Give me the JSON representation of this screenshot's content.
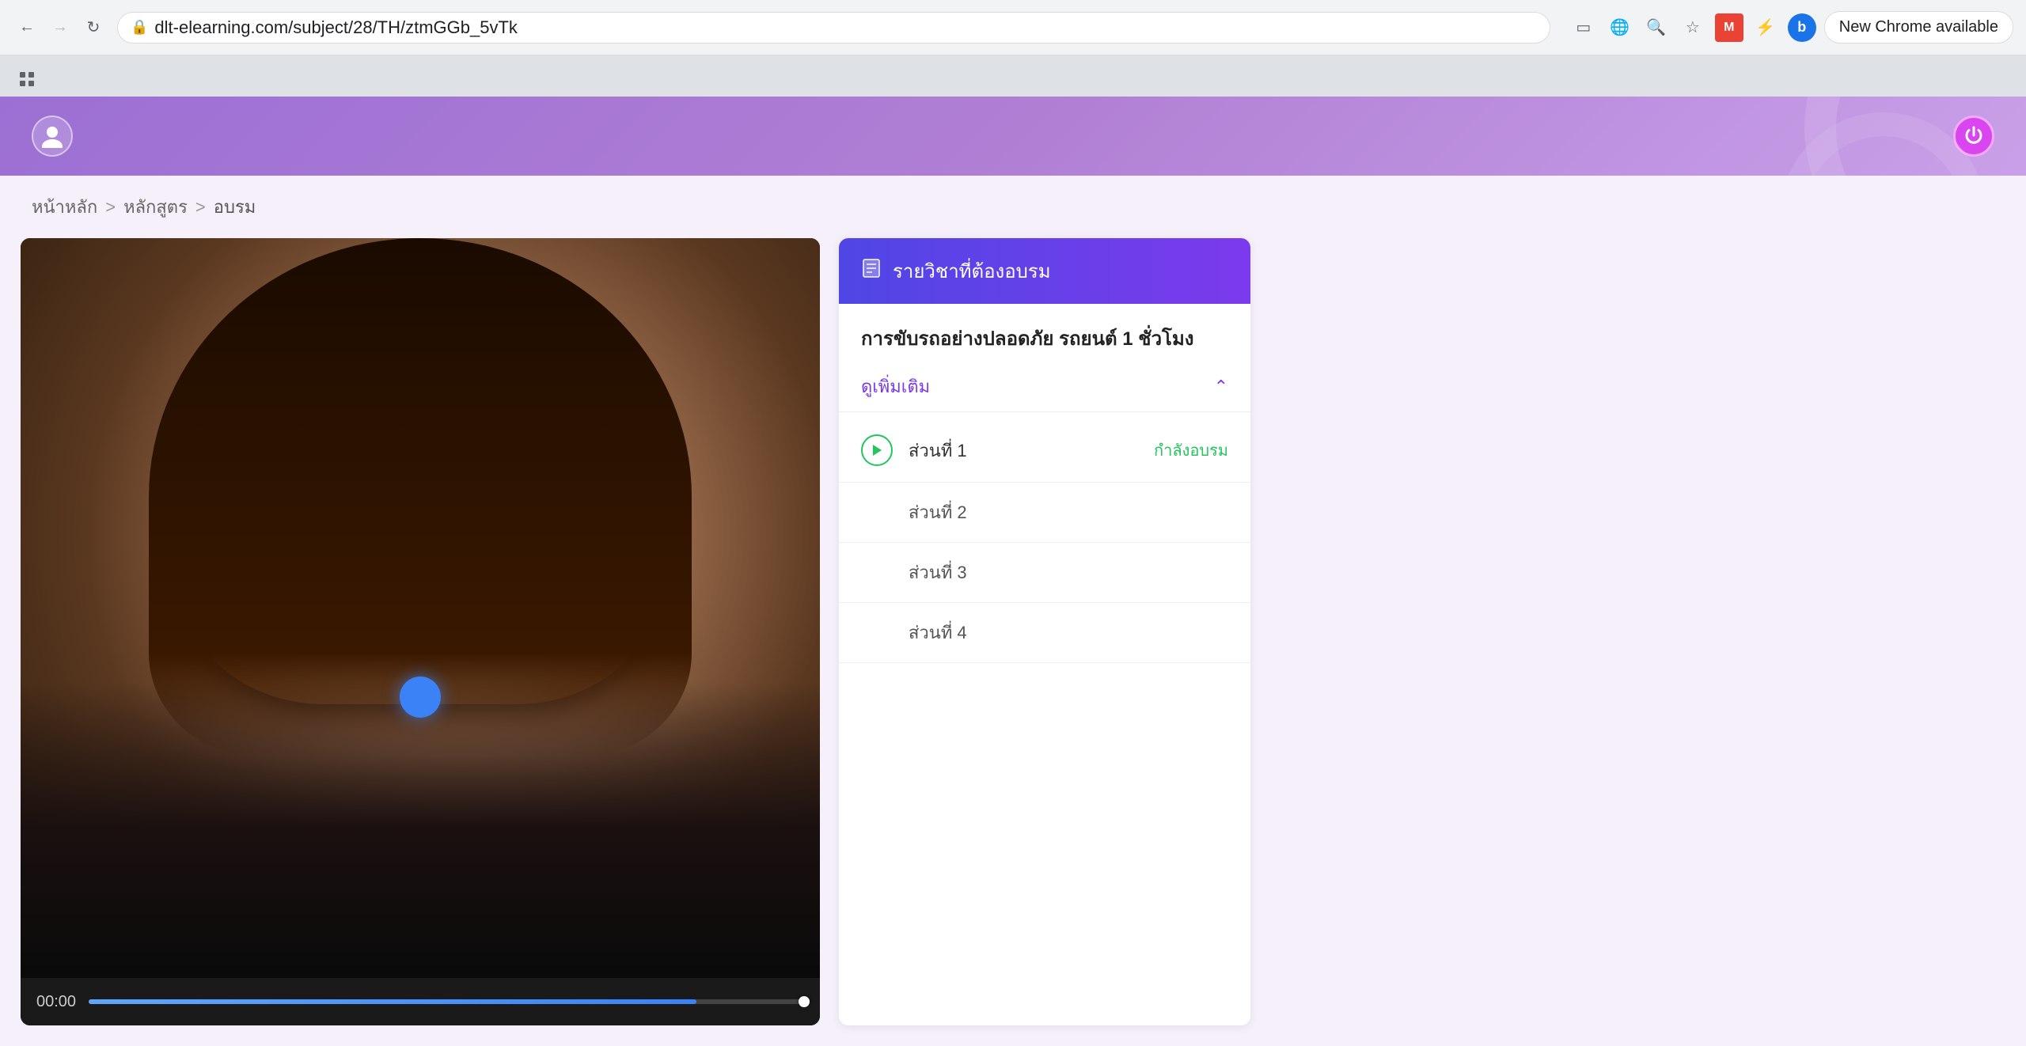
{
  "browser": {
    "url": "dlt-elearning.com/subject/28/TH/ztmGGb_5vTk",
    "new_chrome_label": "New Chrome available",
    "profile_initial": "b",
    "back_disabled": false,
    "forward_disabled": true
  },
  "breadcrumb": {
    "home": "หน้าหลัก",
    "sep1": ">",
    "course": "หลักสูตร",
    "sep2": ">",
    "current": "อบรม"
  },
  "sidebar": {
    "header_label": "รายวิชาที่ต้องอบรม",
    "course_title": "การขับรถอย่างปลอดภัย รถยนต์ 1 ชั่วโมง",
    "expand_link": "ดูเพิ่มเติม",
    "lessons": [
      {
        "name": "ส่วนที่ 1",
        "status": "กำลังอบรม",
        "has_play": true
      },
      {
        "name": "ส่วนที่ 2",
        "status": "",
        "has_play": false
      },
      {
        "name": "ส่วนที่ 3",
        "status": "",
        "has_play": false
      },
      {
        "name": "ส่วนที่ 4",
        "status": "",
        "has_play": false
      }
    ]
  },
  "video": {
    "time": "00:00",
    "progress_percent": 85
  },
  "colors": {
    "header_purple": "#9c6fd4",
    "sidebar_gradient_start": "#4f46e5",
    "sidebar_gradient_end": "#7c3aed",
    "status_green": "#22c55e",
    "blue_dot": "#3b82f6"
  }
}
